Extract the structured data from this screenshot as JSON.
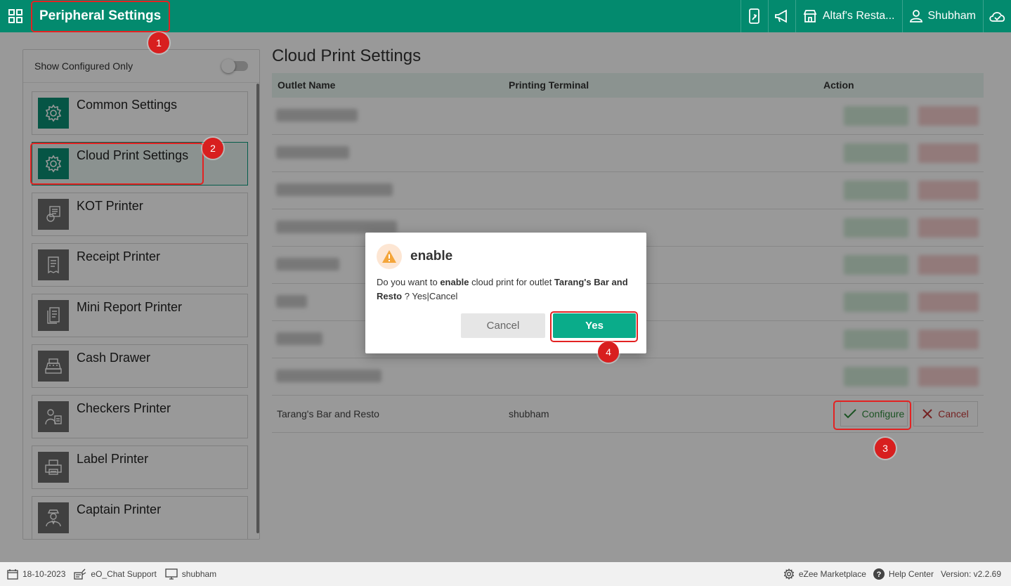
{
  "header": {
    "title": "Peripheral Settings",
    "outlet": "Altaf's Resta...",
    "user": "Shubham"
  },
  "sidebar": {
    "filter_label": "Show Configured Only",
    "filter_on": false,
    "items": [
      {
        "label": "Common Settings",
        "icon": "gear-icon"
      },
      {
        "label": "Cloud Print Settings",
        "icon": "gear-icon"
      },
      {
        "label": "KOT Printer",
        "icon": "kot-printer-icon"
      },
      {
        "label": "Receipt Printer",
        "icon": "receipt-icon"
      },
      {
        "label": "Mini Report Printer",
        "icon": "report-icon"
      },
      {
        "label": "Cash Drawer",
        "icon": "cash-register-icon"
      },
      {
        "label": "Checkers Printer",
        "icon": "checker-icon"
      },
      {
        "label": "Label Printer",
        "icon": "label-printer-icon"
      },
      {
        "label": "Captain Printer",
        "icon": "captain-icon"
      }
    ]
  },
  "main": {
    "title": "Cloud Print Settings",
    "columns": [
      "Outlet Name",
      "Printing Terminal",
      "Action"
    ],
    "last_row": {
      "outlet": "Tarang's Bar and Resto",
      "terminal": "shubham",
      "configure_label": "Configure",
      "cancel_label": "Cancel"
    }
  },
  "dialog": {
    "title": "enable",
    "msg_prefix": "Do you want to ",
    "msg_action": "enable",
    "msg_mid": " cloud print for outlet ",
    "msg_outlet": "Tarang's Bar and Resto",
    "msg_suffix": " ? Yes|Cancel",
    "cancel_label": "Cancel",
    "yes_label": "Yes"
  },
  "footer": {
    "date": "18-10-2023",
    "chat": "eO_Chat Support",
    "terminal": "shubham",
    "marketplace": "eZee Marketplace",
    "help": "Help Center",
    "version": "Version: v2.2.69"
  },
  "badges": [
    "1",
    "2",
    "3",
    "4"
  ],
  "colors": {
    "brand": "#038a6e",
    "accent": "#0aac8a",
    "annotation": "#d81f1f"
  }
}
